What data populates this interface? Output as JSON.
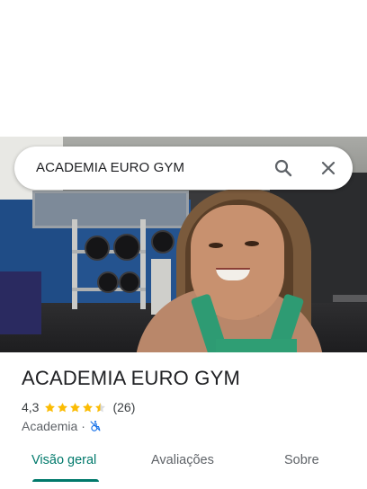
{
  "search": {
    "query": "ACADEMIA EURO GYM",
    "icons": {
      "search": "search-icon",
      "close": "close-icon"
    }
  },
  "place": {
    "name": "ACADEMIA EURO GYM",
    "rating": "4,3",
    "stars": 4.3,
    "review_count": "(26)",
    "category": "Academia",
    "separator": "·",
    "accessibility_icon": "not-accessible-wheelchair-icon"
  },
  "tabs": [
    {
      "label": "Visão geral",
      "active": true
    },
    {
      "label": "Avaliações",
      "active": false
    },
    {
      "label": "Sobre",
      "active": false
    }
  ],
  "colors": {
    "accent": "#00796b",
    "star": "#fbbc04",
    "accessibility": "#1a73e8"
  }
}
